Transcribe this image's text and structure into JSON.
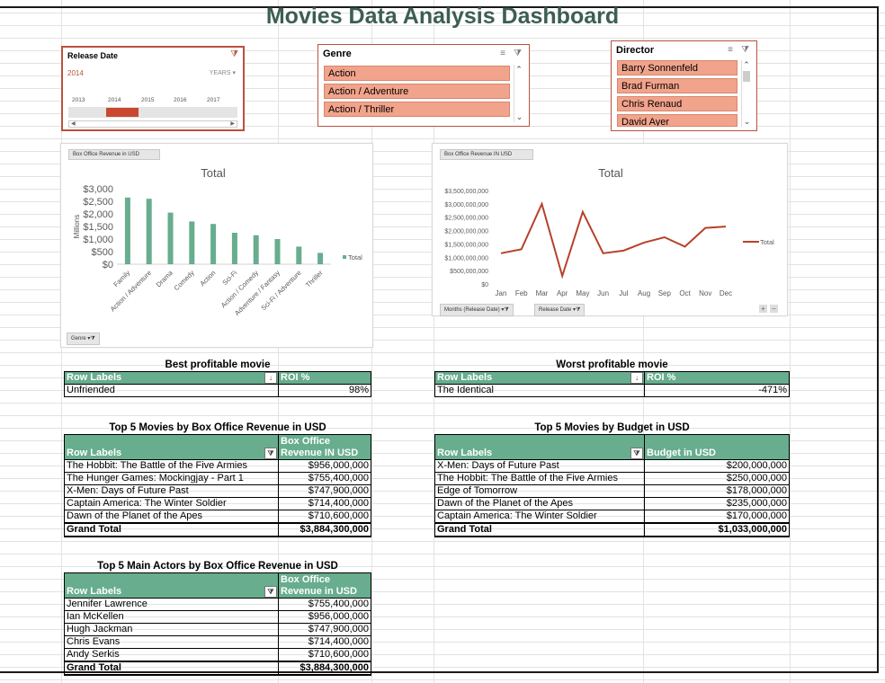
{
  "dashboard_title": "Movies Data Analysis Dashboard",
  "slicer_release": {
    "header": "Release Date",
    "selected_period": "2014",
    "unit_label": "YEARS",
    "years": [
      "2013",
      "2014",
      "2015",
      "2016",
      "2017"
    ],
    "selected_year": "2014"
  },
  "slicer_genre": {
    "header": "Genre",
    "items": [
      "Action",
      "Action / Adventure",
      "Action / Thriller"
    ]
  },
  "slicer_director": {
    "header": "Director",
    "items": [
      "Barry Sonnenfeld",
      "Brad Furman",
      "Chris Renaud",
      "David Ayer"
    ]
  },
  "bar_chart": {
    "field_button": "Box Office Revenue in USD",
    "genre_button": "Genre",
    "legend_label": "Total"
  },
  "line_chart": {
    "field_button": "Box Office Revenue IN USD",
    "months_button": "Months (Release Date)",
    "release_button": "Release Date",
    "legend_label": "Total"
  },
  "chart_data": [
    {
      "type": "bar",
      "title": "Total",
      "ylabel": "Millions",
      "categories": [
        "Family",
        "Action / Adventure",
        "Drama",
        "Comedy",
        "Action",
        "Sci-Fi",
        "Action / Comedy",
        "Adventure / Fantasy",
        "Sci-Fi / Adventure",
        "Thriller"
      ],
      "series": [
        {
          "name": "Total",
          "values": [
            2650,
            2600,
            2050,
            1700,
            1600,
            1250,
            1150,
            1000,
            700,
            450
          ]
        }
      ],
      "yticks": [
        "$3,000",
        "$2,500",
        "$2,000",
        "$1,500",
        "$1,000",
        "$500",
        "$0"
      ],
      "ylim": [
        0,
        3000
      ],
      "color": "#67ad8e",
      "legend_position": "right"
    },
    {
      "type": "line",
      "title": "Total",
      "categories": [
        "Jan",
        "Feb",
        "Mar",
        "Apr",
        "May",
        "Jun",
        "Jul",
        "Aug",
        "Sep",
        "Oct",
        "Nov",
        "Dec"
      ],
      "series": [
        {
          "name": "Total",
          "values": [
            1150000000,
            1300000000,
            3000000000,
            300000000,
            2700000000,
            1150000000,
            1250000000,
            1550000000,
            1750000000,
            1400000000,
            2100000000,
            2150000000
          ]
        }
      ],
      "yticks": [
        "$3,500,000,000",
        "$3,000,000,000",
        "$2,500,000,000",
        "$2,000,000,000",
        "$1,500,000,000",
        "$1,000,000,000",
        "$500,000,000",
        "$0"
      ],
      "ylim": [
        0,
        3500000000
      ],
      "color": "#b7412a",
      "legend_position": "right"
    }
  ],
  "best_profitable": {
    "title": "Best profitable movie",
    "col1": "Row Labels",
    "col2": "ROI %",
    "row_label": "Unfriended",
    "row_value": "98%"
  },
  "worst_profitable": {
    "title": "Worst profitable movie",
    "col1": "Row Labels",
    "col2": "ROI %",
    "row_label": "The Identical",
    "row_value": "-471%"
  },
  "top5_revenue": {
    "title": "Top 5 Movies by Box Office Revenue in USD",
    "col1": "Row Labels",
    "col2": "Box Office Revenue IN USD",
    "rows": [
      {
        "label": "The Hobbit: The Battle of the Five Armies",
        "value": "$956,000,000"
      },
      {
        "label": "The Hunger Games: Mockingjay - Part 1",
        "value": "$755,400,000"
      },
      {
        "label": "X-Men: Days of Future Past",
        "value": "$747,900,000"
      },
      {
        "label": "Captain America: The Winter Soldier",
        "value": "$714,400,000"
      },
      {
        "label": "Dawn of the Planet of the Apes",
        "value": "$710,600,000"
      }
    ],
    "grand_label": "Grand Total",
    "grand_value": "$3,884,300,000"
  },
  "top5_budget": {
    "title": "Top 5 Movies by Budget in USD",
    "col1": "Row Labels",
    "col2": "Budget in USD",
    "rows": [
      {
        "label": "X-Men: Days of Future Past",
        "value": "$200,000,000"
      },
      {
        "label": "The Hobbit: The Battle of the Five Armies",
        "value": "$250,000,000"
      },
      {
        "label": "Edge of Tomorrow",
        "value": "$178,000,000"
      },
      {
        "label": "Dawn of the Planet of the Apes",
        "value": "$235,000,000"
      },
      {
        "label": "Captain America: The Winter Soldier",
        "value": "$170,000,000"
      }
    ],
    "grand_label": "Grand Total",
    "grand_value": "$1,033,000,000"
  },
  "top5_actors": {
    "title": "Top 5 Main Actors by Box Office Revenue in USD",
    "col1": "Row Labels",
    "col2": "Box Office Revenue in USD",
    "rows": [
      {
        "label": "Jennifer Lawrence",
        "value": "$755,400,000"
      },
      {
        "label": "Ian McKellen",
        "value": "$956,000,000"
      },
      {
        "label": "Hugh Jackman",
        "value": "$747,900,000"
      },
      {
        "label": "Chris Evans",
        "value": "$714,400,000"
      },
      {
        "label": "Andy Serkis",
        "value": "$710,600,000"
      }
    ],
    "grand_label": "Grand Total",
    "grand_value": "$3,884,300,000"
  }
}
